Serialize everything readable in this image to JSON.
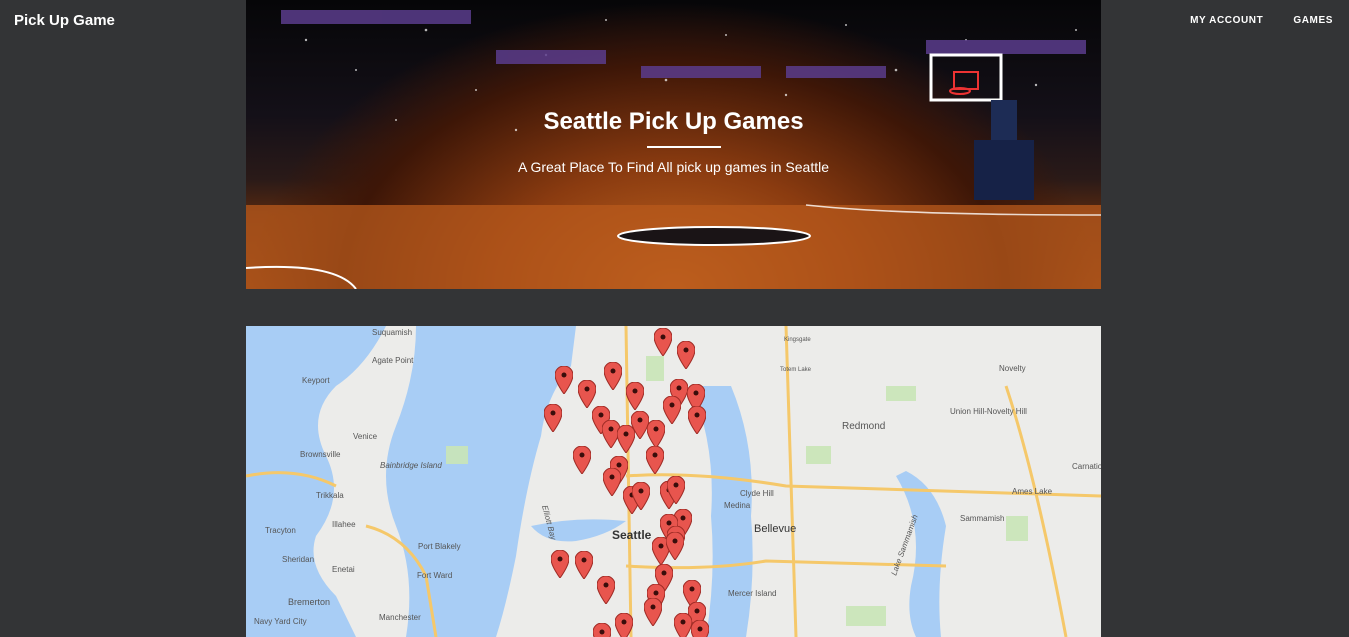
{
  "nav": {
    "brand": "Pick Up Game",
    "links": [
      "MY ACCOUNT",
      "GAMES"
    ]
  },
  "hero": {
    "title": "Seattle Pick Up Games",
    "subtitle": "A Great Place To Find All pick up games in Seattle"
  },
  "map": {
    "labels": [
      "Suquamish",
      "Agate Point",
      "Keyport",
      "Venice",
      "Brownsville",
      "Bainbridge Island",
      "Trikkala",
      "Illahee",
      "Tracyton",
      "Sheridan",
      "Enetai",
      "Port Blakely",
      "Fort Ward",
      "Bremerton",
      "Manchester",
      "Navy Yard City",
      "Seattle",
      "Clyde Hill",
      "Medina",
      "Bellevue",
      "Mercer Island",
      "Redmond",
      "Union Hill-Novelty Hill",
      "Novelty",
      "Ames Lake",
      "Sammamish",
      "Carnation",
      "Kingsgate",
      "Totem Lake",
      "Lake Sammamish",
      "Elliott Bay"
    ],
    "pin_color": "#e8554e"
  }
}
